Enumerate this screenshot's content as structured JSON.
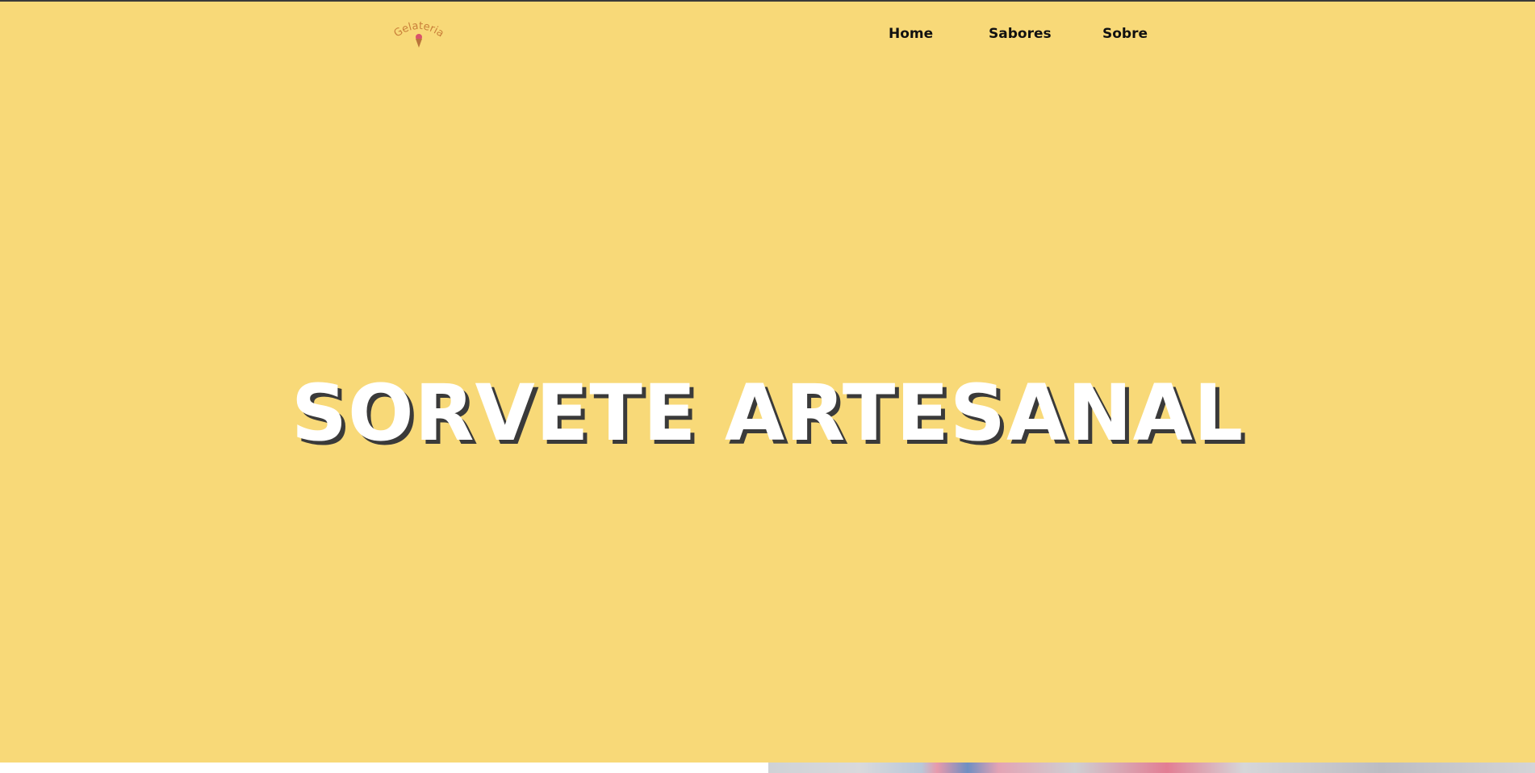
{
  "brand": {
    "logo_text": "Gelateria",
    "logo_icon": "ice-cream-cone-icon",
    "logo_color": "#c9803a"
  },
  "nav": {
    "items": [
      {
        "label": "Home"
      },
      {
        "label": "Sabores"
      },
      {
        "label": "Sobre"
      }
    ]
  },
  "hero": {
    "title": "SORVETE ARTESANAL",
    "background_color": "#f8d978",
    "title_color": "#ffffff",
    "title_shadow_color": "#3a3a3a"
  }
}
